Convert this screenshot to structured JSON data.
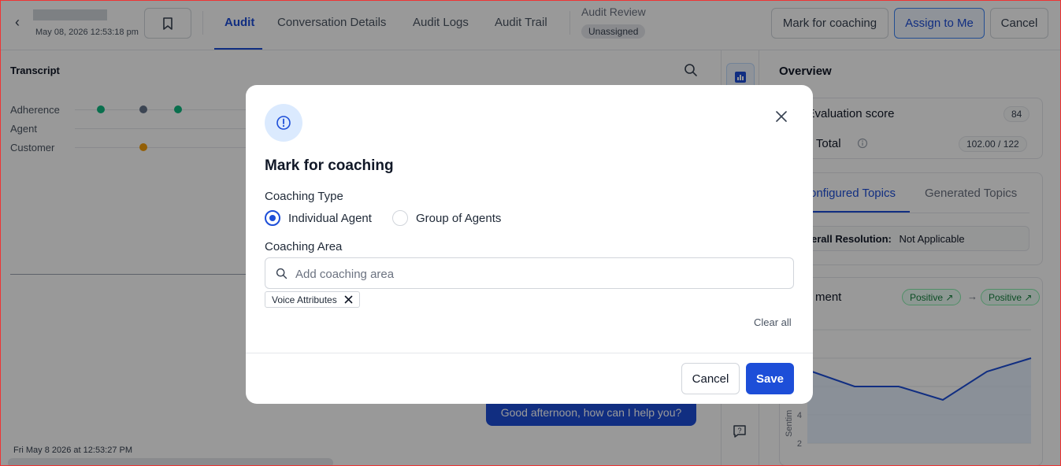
{
  "header": {
    "date": "May 08, 2026 12:53:18 pm",
    "tabs": [
      {
        "label": "Audit",
        "active": true
      },
      {
        "label": "Conversation Details",
        "active": false
      },
      {
        "label": "Audit Logs",
        "active": false
      },
      {
        "label": "Audit Trail",
        "active": false
      }
    ],
    "audit_review_label": "Audit Review",
    "audit_status": "Unassigned",
    "buttons": {
      "mark_coaching": "Mark for coaching",
      "assign": "Assign to Me",
      "cancel": "Cancel"
    }
  },
  "transcript": {
    "title": "Transcript",
    "tracks": [
      {
        "label": "Adherence"
      },
      {
        "label": "Agent"
      },
      {
        "label": "Customer"
      }
    ],
    "message": "Good afternoon, how can I help you?",
    "timestamp": "Fri May 8 2026 at 12:53:27 PM"
  },
  "overview": {
    "title": "Overview",
    "evaluation_label": "e Evaluation score",
    "evaluation_value": "84",
    "points_label": "nts Total",
    "points_value": "102.00 / 122",
    "tabs": [
      "onfigured Topics",
      "Generated Topics"
    ],
    "resolution_label": "erall Resolution:",
    "resolution_value": "Not Applicable",
    "sentiment_label": "ment",
    "sentiment_from": "Positive ↗",
    "sentiment_arrow": "→",
    "sentiment_to": "Positive ↗",
    "chart_ylabel": "Sentim",
    "chart_ticks": [
      "4",
      "2"
    ]
  },
  "modal": {
    "title": "Mark for coaching",
    "coaching_type_label": "Coaching Type",
    "options": [
      "Individual Agent",
      "Group of Agents"
    ],
    "selected_option": "Individual Agent",
    "coaching_area_label": "Coaching Area",
    "search_placeholder": "Add coaching area",
    "search_value": "",
    "chips": [
      "Voice Attributes"
    ],
    "clear_all": "Clear all",
    "cancel": "Cancel",
    "save": "Save"
  },
  "colors": {
    "accent": "#1d4ed8",
    "positive": "#15803d",
    "adherence_dot": "#10b981",
    "neutral_dot": "#64748b"
  }
}
